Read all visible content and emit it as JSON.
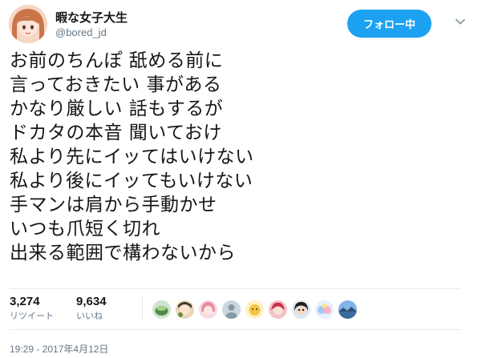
{
  "author": {
    "display_name": "暇な女子大生",
    "handle": "@bored_jd",
    "avatar_icon": "user-avatar-anime-girl-icon"
  },
  "follow_button": {
    "label": "フォロー中"
  },
  "more_menu": {
    "icon": "chevron-down-icon"
  },
  "tweet": {
    "lines": [
      "お前のちんぽ 舐める前に",
      "言っておきたい 事がある",
      "かなり厳しい 話もするが",
      "ドカタの本音 聞いておけ",
      "私より先にイッてはいけない",
      "私より後にイッてもいけない",
      "手マンは肩から手動かせ",
      "いつも爪短く切れ",
      "出来る範囲で構わないから"
    ]
  },
  "stats": {
    "retweets": {
      "count": "3,274",
      "label": "リツイート"
    },
    "likes": {
      "count": "9,634",
      "label": "いいね"
    }
  },
  "liker_avatars": [
    "avatar-green-bowl-icon",
    "avatar-anime-icon",
    "avatar-anime-pink-icon",
    "avatar-default-gray-icon",
    "avatar-yellow-character-icon",
    "avatar-red-character-icon",
    "avatar-dark-hair-icon",
    "avatar-colorful-anime-icon",
    "avatar-sky-photo-icon"
  ],
  "timestamp": "19:29 - 2017年4月12日",
  "colors": {
    "accent": "#1da1f2",
    "text": "#14171a",
    "secondary_text": "#657786",
    "divider": "#e6ecf0"
  }
}
